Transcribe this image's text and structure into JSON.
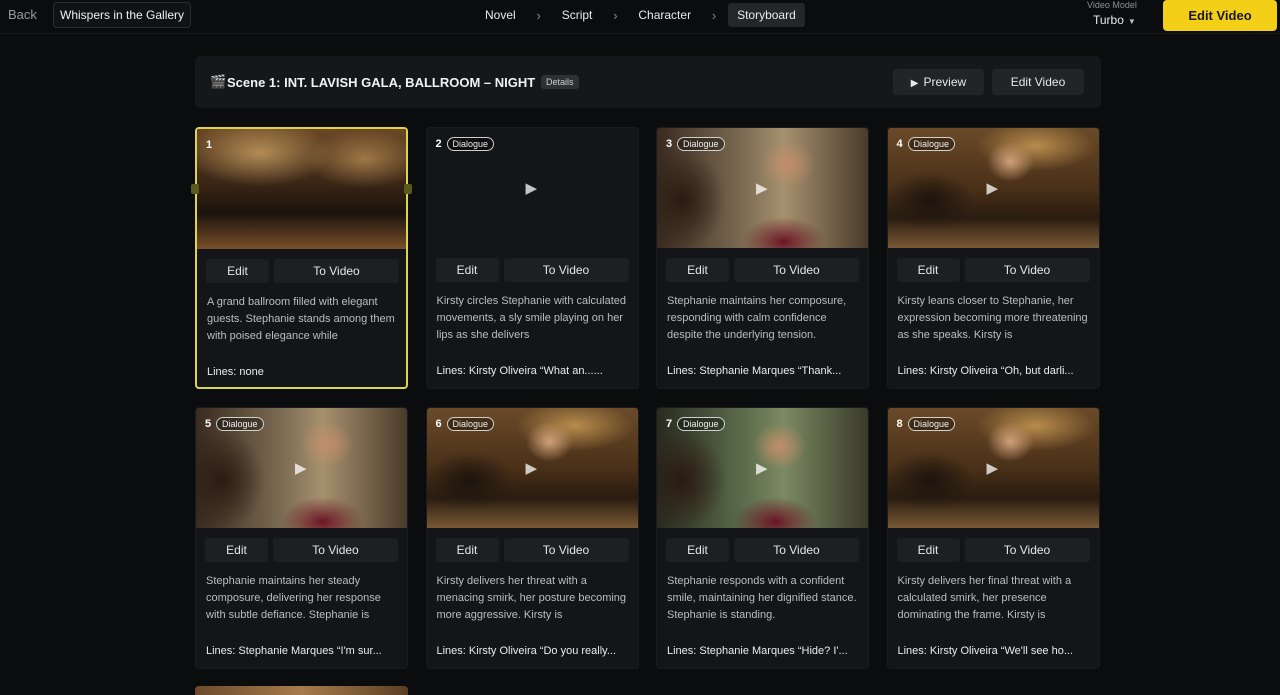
{
  "header": {
    "back_label": "Back",
    "project_title": "Whispers in the Gallery",
    "steps": [
      "Novel",
      "Script",
      "Character",
      "Storyboard"
    ],
    "active_step": "Storyboard",
    "model_label": "Video Model",
    "model_value": "Turbo",
    "edit_video_label": "Edit Video"
  },
  "scene": {
    "icon": "clapperboard-icon",
    "title": "Scene 1: INT. LAVISH GALA, BALLROOM – NIGHT",
    "details_label": "Details",
    "preview_label": "Preview",
    "edit_video_label": "Edit Video"
  },
  "card_labels": {
    "edit": "Edit",
    "to_video": "To Video",
    "badge": "Dialogue"
  },
  "cards": [
    {
      "num": "1",
      "badge": "",
      "desc": "A grand ballroom filled with elegant guests. Stephanie stands among them with poised elegance while",
      "lines": "Lines:  none",
      "selected": true
    },
    {
      "num": "2",
      "badge": "Dialogue",
      "desc": "Kirsty circles Stephanie with calculated movements, a sly smile playing on her lips as she delivers",
      "lines": "Lines: Kirsty Oliveira “What an......"
    },
    {
      "num": "3",
      "badge": "Dialogue",
      "desc": "Stephanie maintains her composure, responding with calm confidence despite the underlying tension.",
      "lines": "Lines: Stephanie Marques “Thank..."
    },
    {
      "num": "4",
      "badge": "Dialogue",
      "desc": "Kirsty leans closer to Stephanie, her expression becoming more threatening as she speaks. Kirsty is",
      "lines": "Lines: Kirsty Oliveira “Oh, but darli..."
    },
    {
      "num": "5",
      "badge": "Dialogue",
      "desc": "Stephanie maintains her steady composure, delivering her response with subtle defiance. Stephanie is",
      "lines": "Lines: Stephanie Marques “I'm sur..."
    },
    {
      "num": "6",
      "badge": "Dialogue",
      "desc": "Kirsty delivers her threat with a menacing smirk, her posture becoming more aggressive. Kirsty is",
      "lines": "Lines: Kirsty Oliveira “Do you really..."
    },
    {
      "num": "7",
      "badge": "Dialogue",
      "desc": "Stephanie responds with a confident smile, maintaining her dignified stance. Stephanie is standing.",
      "lines": "Lines: Stephanie Marques “Hide? I'..."
    },
    {
      "num": "8",
      "badge": "Dialogue",
      "desc": "Kirsty delivers her final threat with a calculated smirk, her presence dominating the frame. Kirsty is",
      "lines": "Lines: Kirsty Oliveira “We'll see ho..."
    }
  ],
  "colors": {
    "accent": "#f4cf17",
    "selected_border": "#dcd44a",
    "background": "#0b0c0e"
  }
}
